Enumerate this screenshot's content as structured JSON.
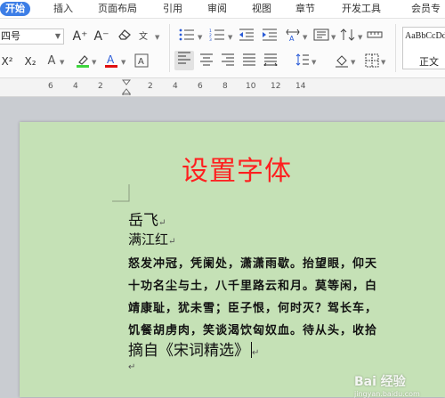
{
  "tabs": [
    {
      "label": "开始",
      "active": true
    },
    {
      "label": "插入"
    },
    {
      "label": "页面布局"
    },
    {
      "label": "引用"
    },
    {
      "label": "审阅"
    },
    {
      "label": "视图"
    },
    {
      "label": "章节"
    },
    {
      "label": "开发工具"
    },
    {
      "label": "会员专"
    }
  ],
  "font_size_value": "四号",
  "toolbar": {
    "grow_font": "A⁺",
    "shrink_font": "A⁻",
    "superscript": "X²",
    "subscript": "X₂",
    "text_effect": "A",
    "highlight": "✎",
    "font_color": "A",
    "char_border": "A"
  },
  "styles_gallery": {
    "sample": "AaBbCcDd",
    "name": "正文"
  },
  "ruler_numbers": [
    "6",
    "4",
    "2",
    "2",
    "4",
    "6",
    "8",
    "10",
    "12",
    "14"
  ],
  "document": {
    "title": "设置字体",
    "author": "岳飞",
    "poem_title": "满江红",
    "verses": [
      "怒发冲冠，凭阑处，潇潇雨歇。抬望眼，仰天",
      "十功名尘与土，八千里路云和月。莫等闲，白",
      "靖康耻，犹未雪；臣子恨，何时灭？驾长车，",
      "饥餐胡虏肉，笑谈渴饮匈奴血。待从头，收拾"
    ],
    "source": "摘自《宋词精选》",
    "paragraph_mark": "↵"
  },
  "watermark": {
    "brand": "Bai 经验",
    "url": "jingyan.baidu.com"
  },
  "colors": {
    "page_bg": "#c5e1b6",
    "title_red": "#ff1f1f",
    "accent_blue": "#3d7ee6",
    "highlight_green": "#3ed63e",
    "font_color_red": "#e01010"
  }
}
